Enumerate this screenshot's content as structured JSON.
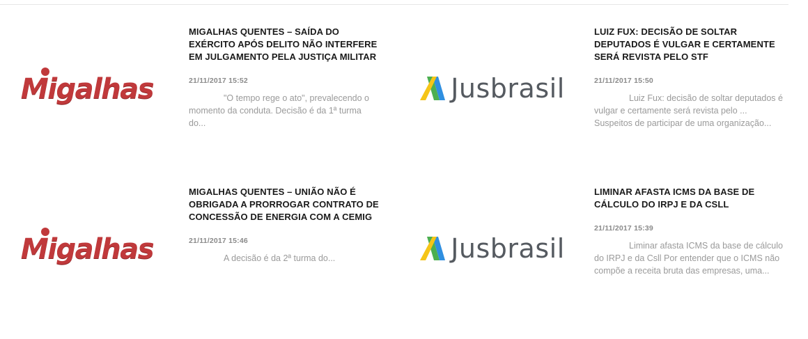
{
  "articles": [
    {
      "source": "Migalhas",
      "title": "MIGALHAS QUENTES – SAÍDA DO EXÉRCITO APÓS DELITO NÃO INTERFERE EM JULGAMENTO PELA JUSTIÇA MILITAR",
      "date": "21/11/2017 15:52",
      "excerpt": "\"O tempo rege o ato\", prevalecendo o momento da conduta. Decisão é da 1ª turma do..."
    },
    {
      "source": "Jusbrasil",
      "title": "LUIZ FUX: DECISÃO DE SOLTAR DEPUTADOS É VULGAR E CERTAMENTE SERÁ REVISTA PELO STF",
      "date": "21/11/2017 15:50",
      "excerpt": "Luiz Fux: decisão de soltar deputados é vulgar e certamente será revista pelo ... Suspeitos de participar de uma organização..."
    },
    {
      "source": "Migalhas",
      "title": "MIGALHAS QUENTES – UNIÃO NÃO É OBRIGADA A PRORROGAR CONTRATO DE CONCESSÃO DE ENERGIA COM A CEMIG",
      "date": "21/11/2017 15:46",
      "excerpt": "A decisão é da 2ª turma do..."
    },
    {
      "source": "Jusbrasil",
      "title": "LIMINAR AFASTA ICMS DA BASE DE CÁLCULO DO IRPJ E DA CSLL",
      "date": "21/11/2017 15:39",
      "excerpt": "Liminar afasta ICMS da base de cálculo do IRPJ e da Csll Por entender que o ICMS não compõe a receita bruta das empresas, uma..."
    }
  ],
  "colors": {
    "migalhas_red": "#c0393b",
    "jusbrasil_yellow": "#f5c518",
    "jusbrasil_green": "#4caf50",
    "jusbrasil_blue": "#2f8fe0",
    "jusbrasil_text": "#555a60"
  },
  "icons": [
    "migalhas-logo",
    "jusbrasil-logo"
  ]
}
